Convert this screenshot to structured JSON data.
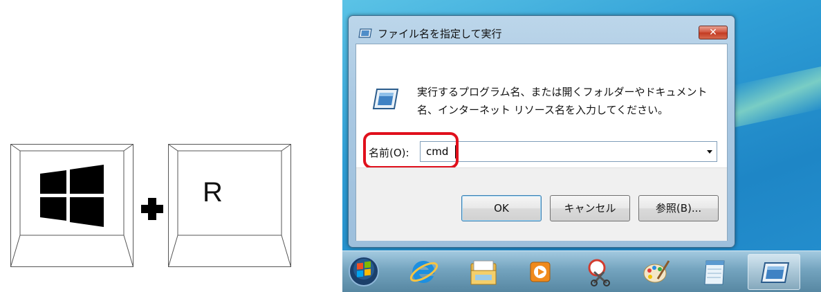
{
  "keys": {
    "key1_icon": "windows-logo-icon",
    "plus_icon": "plus-icon",
    "key2_label": "R"
  },
  "dialog": {
    "title": "ファイル名を指定して実行",
    "close_label": "✕",
    "description": "実行するプログラム名、または開くフォルダーやドキュメント名、インターネット リソース名を入力してください。",
    "name_label": "名前(O):",
    "name_value": "cmd",
    "highlight_color": "#e0101c",
    "buttons": {
      "ok": "OK",
      "cancel": "キャンセル",
      "browse": "参照(B)..."
    }
  },
  "taskbar": {
    "icons": [
      "start-orb-icon",
      "internet-explorer-icon",
      "file-explorer-icon",
      "media-player-icon",
      "snipping-tool-icon",
      "paint-icon",
      "notepad-icon",
      "run-dialog-icon"
    ],
    "active_icon": "run-dialog-icon"
  }
}
